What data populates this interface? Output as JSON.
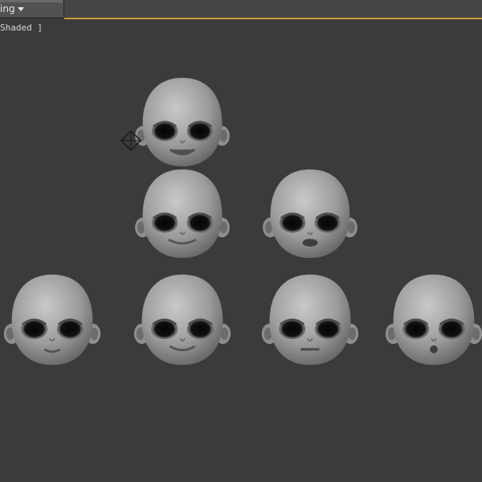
{
  "toolbar": {
    "menu_label": "ing"
  },
  "viewport": {
    "shading_label": "Shaded ]"
  },
  "colors": {
    "background": "#3b3b3b",
    "accent_line": "#c79a3c",
    "head_fill": "#9a9a9a"
  },
  "scene": {
    "object_count": 7,
    "icons": [
      "camera-gizmo-icon"
    ]
  }
}
